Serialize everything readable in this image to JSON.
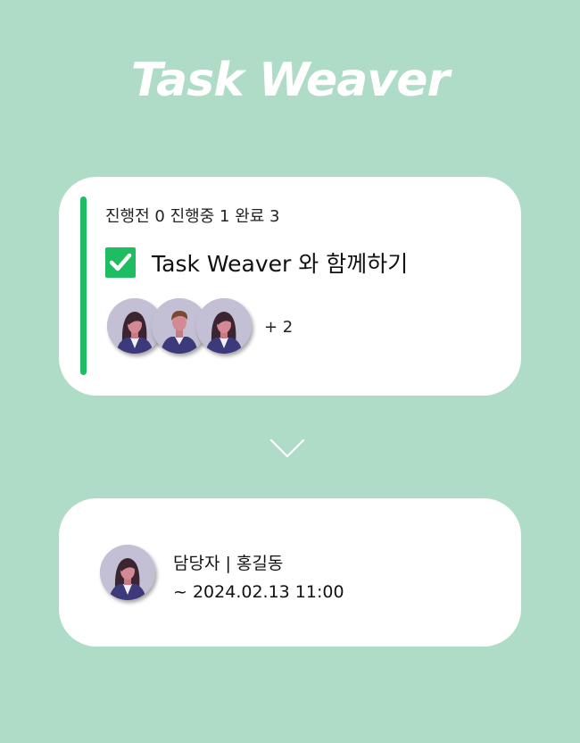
{
  "app": {
    "title": "Task Weaver"
  },
  "colors": {
    "background": "#afdcc6",
    "accent": "#1fbd62",
    "card": "#ffffff"
  },
  "task_card": {
    "counts": {
      "todo_label": "진행전",
      "todo_value": "0",
      "doing_label": "진행중",
      "doing_value": "1",
      "done_label": "완료",
      "done_value": "3"
    },
    "checked": true,
    "title": "Task Weaver 와 함께하기",
    "members": [
      {
        "icon": "avatar-woman"
      },
      {
        "icon": "avatar-man"
      },
      {
        "icon": "avatar-woman"
      }
    ],
    "extra_members": "+ 2"
  },
  "expand_icon": "chevron-down-icon",
  "assignee_card": {
    "avatar_icon": "avatar-woman",
    "assignee": "담당자 | 홍길동",
    "due": "~ 2024.02.13 11:00"
  }
}
